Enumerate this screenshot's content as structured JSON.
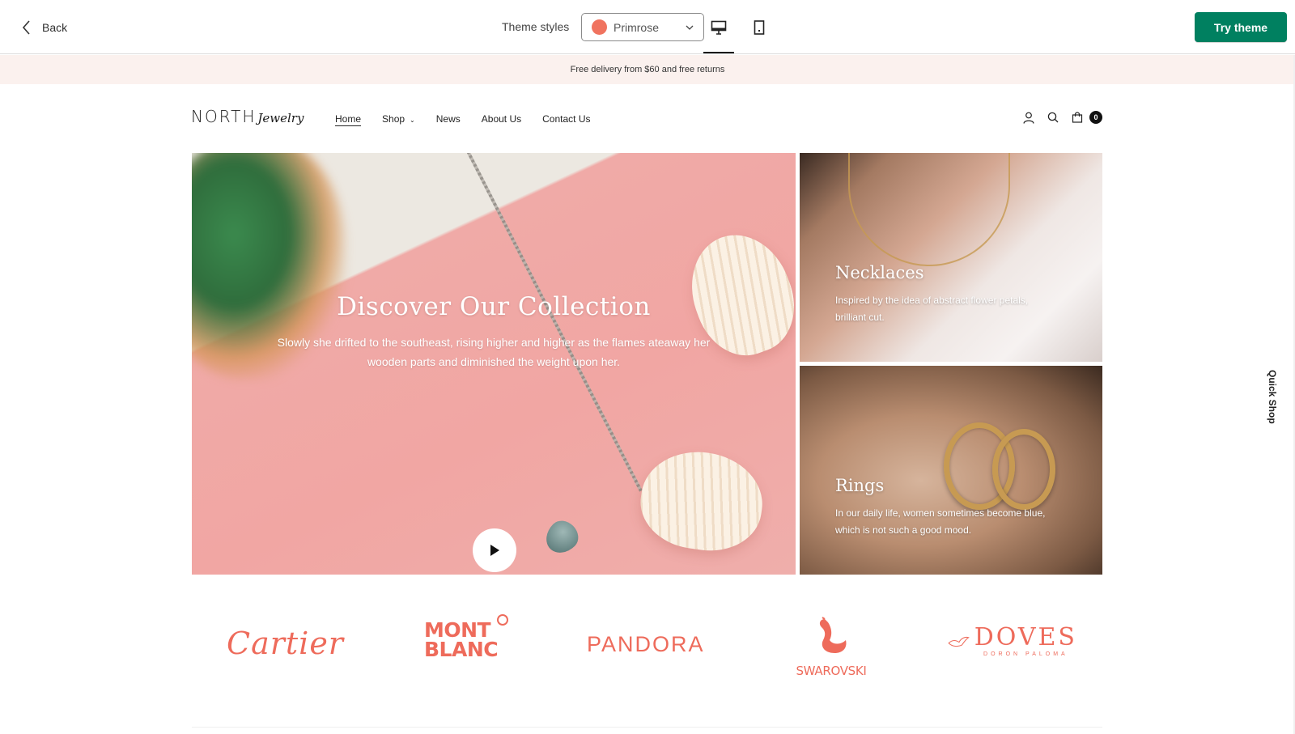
{
  "preview_bar": {
    "back_label": "Back",
    "theme_styles_label": "Theme styles",
    "theme_style_value": "Primrose",
    "theme_style_color": "#f0735f",
    "try_theme_label": "Try theme",
    "accent_color": "#008060",
    "device_options": [
      "desktop",
      "mobile"
    ],
    "selected_device": "desktop"
  },
  "store": {
    "announcement": "Free delivery from $60 and free returns",
    "logo": {
      "primary": "NORTH",
      "script": "Jewelry"
    },
    "nav": [
      {
        "label": "Home",
        "active": true
      },
      {
        "label": "Shop",
        "has_dropdown": true
      },
      {
        "label": "News"
      },
      {
        "label": "About Us"
      },
      {
        "label": "Contact Us"
      }
    ],
    "header_icons": [
      "user-icon",
      "search-icon",
      "cart-icon"
    ],
    "cart_count": "0",
    "hero": {
      "title": "Discover Our Collection",
      "text": "Slowly she drifted to the southeast, rising higher and higher as the flames ateaway her wooden parts and diminished the weight upon her."
    },
    "tiles": [
      {
        "title": "Necklaces",
        "text": "Inspired by the idea of abstract flower petals, brilliant cut."
      },
      {
        "title": "Rings",
        "text": "In our daily life, women sometimes become blue, which is not such a good mood."
      }
    ],
    "brands": [
      {
        "name": "Cartier"
      },
      {
        "name_line1": "MONT",
        "name_line2": "BLANC"
      },
      {
        "name": "PANDORA"
      },
      {
        "name": "SWAROVSKI"
      },
      {
        "name": "DOVES",
        "sub": "DORON PALOMA"
      }
    ],
    "brand_color": "#ee6b5b",
    "quick_shop_label": "Quick Shop"
  }
}
